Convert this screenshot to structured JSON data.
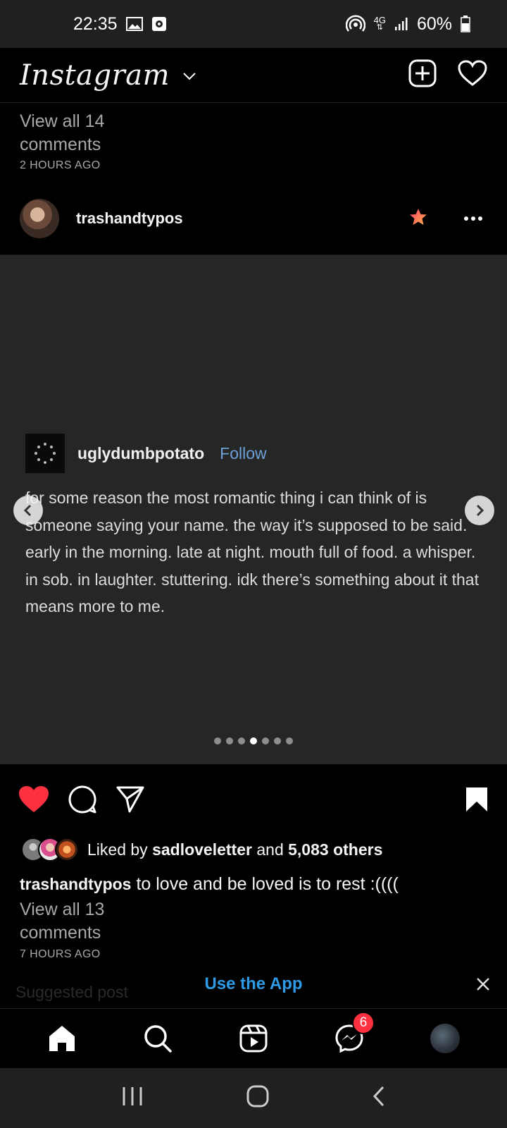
{
  "status_bar": {
    "time": "22:35",
    "network": "4G",
    "battery": "60%",
    "icons": [
      "gallery-icon",
      "screen-record-icon",
      "hotspot-icon",
      "signal-icon",
      "battery-icon"
    ]
  },
  "app_bar": {
    "logo": "Instagram",
    "icons": [
      "chevron-down-icon",
      "new-post-icon",
      "activity-heart-icon"
    ]
  },
  "previous_post": {
    "comments_link": "View all 14 comments",
    "time": "2 HOURS AGO"
  },
  "post": {
    "username": "trashandtypos",
    "icons": [
      "favorite-star-icon",
      "more-options-icon"
    ],
    "embedded": {
      "username": "uglydumbpotato",
      "follow_label": "Follow",
      "text": "for some reason the most romantic thing i can think of is someone saying your name. the way it’s supposed to be said. early in the morning. late at night. mouth full of food. a whisper. in sob. in laughter. stuttering. idk there’s something about it that means more to me."
    },
    "carousel": {
      "total": 7,
      "active": 4
    },
    "likes": {
      "prefix": "Liked by",
      "user": "sadloveletter",
      "middle": "and",
      "others": "5,083 others"
    },
    "caption": {
      "username": "trashandtypos",
      "text": "to love and be loved is to rest :(((("
    },
    "comments_link": "View all 13 comments",
    "time": "7 HOURS AGO"
  },
  "banner": {
    "suggested": "Suggested post",
    "use_app": "Use the App"
  },
  "bottom_nav": {
    "items": [
      "home-icon",
      "search-icon",
      "reels-icon",
      "messenger-icon",
      "profile-avatar"
    ],
    "messenger_badge": "6"
  },
  "colors": {
    "like_red": "#ff3040",
    "link_blue": "#2f9ae6",
    "follow_blue": "#6da0d8",
    "card_bg": "#262626"
  }
}
